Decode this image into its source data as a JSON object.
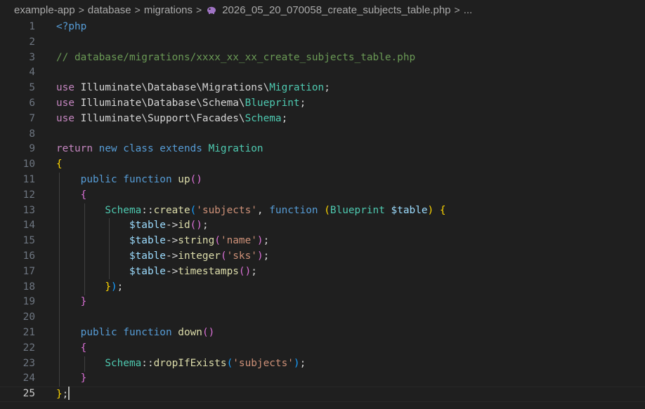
{
  "breadcrumb": {
    "items": [
      "example-app",
      "database",
      "migrations"
    ],
    "file": "2026_05_20_070058_create_subjects_table.php",
    "more": "...",
    "file_icon": "php-elephant-icon",
    "separator": ">"
  },
  "editor": {
    "active_line": 25,
    "lines": [
      {
        "n": "1",
        "tokens": [
          {
            "c": "t-tag",
            "t": "<?php"
          }
        ]
      },
      {
        "n": "2",
        "tokens": []
      },
      {
        "n": "3",
        "tokens": [
          {
            "c": "t-cmt",
            "t": "// database/migrations/xxxx_xx_xx_create_subjects_table.php"
          }
        ]
      },
      {
        "n": "4",
        "tokens": []
      },
      {
        "n": "5",
        "tokens": [
          {
            "c": "t-ctrl",
            "t": "use "
          },
          {
            "c": "t-txt",
            "t": "Illuminate\\Database\\Migrations\\"
          },
          {
            "c": "t-cls",
            "t": "Migration"
          },
          {
            "c": "t-txt",
            "t": ";"
          }
        ]
      },
      {
        "n": "6",
        "tokens": [
          {
            "c": "t-ctrl",
            "t": "use "
          },
          {
            "c": "t-txt",
            "t": "Illuminate\\Database\\Schema\\"
          },
          {
            "c": "t-cls",
            "t": "Blueprint"
          },
          {
            "c": "t-txt",
            "t": ";"
          }
        ]
      },
      {
        "n": "7",
        "tokens": [
          {
            "c": "t-ctrl",
            "t": "use "
          },
          {
            "c": "t-txt",
            "t": "Illuminate\\Support\\Facades\\"
          },
          {
            "c": "t-cls",
            "t": "Schema"
          },
          {
            "c": "t-txt",
            "t": ";"
          }
        ]
      },
      {
        "n": "8",
        "tokens": []
      },
      {
        "n": "9",
        "tokens": [
          {
            "c": "t-ctrl",
            "t": "return "
          },
          {
            "c": "t-kw",
            "t": "new class extends "
          },
          {
            "c": "t-cls",
            "t": "Migration"
          }
        ]
      },
      {
        "n": "10",
        "tokens": [
          {
            "c": "t-b1",
            "t": "{"
          }
        ]
      },
      {
        "n": "11",
        "tokens": [
          {
            "c": "t-txt",
            "t": "    "
          },
          {
            "c": "t-kw",
            "t": "public function "
          },
          {
            "c": "t-fn",
            "t": "up"
          },
          {
            "c": "t-b2",
            "t": "()"
          }
        ]
      },
      {
        "n": "12",
        "tokens": [
          {
            "c": "t-txt",
            "t": "    "
          },
          {
            "c": "t-b2",
            "t": "{"
          }
        ]
      },
      {
        "n": "13",
        "tokens": [
          {
            "c": "t-txt",
            "t": "        "
          },
          {
            "c": "t-cls",
            "t": "Schema"
          },
          {
            "c": "t-op",
            "t": "::"
          },
          {
            "c": "t-fn",
            "t": "create"
          },
          {
            "c": "t-b3",
            "t": "("
          },
          {
            "c": "t-str",
            "t": "'subjects'"
          },
          {
            "c": "t-txt",
            "t": ", "
          },
          {
            "c": "t-kw",
            "t": "function "
          },
          {
            "c": "t-b1",
            "t": "("
          },
          {
            "c": "t-cls",
            "t": "Blueprint "
          },
          {
            "c": "t-var",
            "t": "$table"
          },
          {
            "c": "t-b1",
            "t": ")"
          },
          {
            "c": "t-txt",
            "t": " "
          },
          {
            "c": "t-b1",
            "t": "{"
          }
        ]
      },
      {
        "n": "14",
        "tokens": [
          {
            "c": "t-txt",
            "t": "            "
          },
          {
            "c": "t-var",
            "t": "$table"
          },
          {
            "c": "t-op",
            "t": "->"
          },
          {
            "c": "t-fn",
            "t": "id"
          },
          {
            "c": "t-b2",
            "t": "()"
          },
          {
            "c": "t-txt",
            "t": ";"
          }
        ]
      },
      {
        "n": "15",
        "tokens": [
          {
            "c": "t-txt",
            "t": "            "
          },
          {
            "c": "t-var",
            "t": "$table"
          },
          {
            "c": "t-op",
            "t": "->"
          },
          {
            "c": "t-fn",
            "t": "string"
          },
          {
            "c": "t-b2",
            "t": "("
          },
          {
            "c": "t-str",
            "t": "'name'"
          },
          {
            "c": "t-b2",
            "t": ")"
          },
          {
            "c": "t-txt",
            "t": ";"
          }
        ]
      },
      {
        "n": "16",
        "tokens": [
          {
            "c": "t-txt",
            "t": "            "
          },
          {
            "c": "t-var",
            "t": "$table"
          },
          {
            "c": "t-op",
            "t": "->"
          },
          {
            "c": "t-fn",
            "t": "integer"
          },
          {
            "c": "t-b2",
            "t": "("
          },
          {
            "c": "t-str",
            "t": "'sks'"
          },
          {
            "c": "t-b2",
            "t": ")"
          },
          {
            "c": "t-txt",
            "t": ";"
          }
        ]
      },
      {
        "n": "17",
        "tokens": [
          {
            "c": "t-txt",
            "t": "            "
          },
          {
            "c": "t-var",
            "t": "$table"
          },
          {
            "c": "t-op",
            "t": "->"
          },
          {
            "c": "t-fn",
            "t": "timestamps"
          },
          {
            "c": "t-b2",
            "t": "()"
          },
          {
            "c": "t-txt",
            "t": ";"
          }
        ]
      },
      {
        "n": "18",
        "tokens": [
          {
            "c": "t-txt",
            "t": "        "
          },
          {
            "c": "t-b1",
            "t": "}"
          },
          {
            "c": "t-b3",
            "t": ")"
          },
          {
            "c": "t-txt",
            "t": ";"
          }
        ]
      },
      {
        "n": "19",
        "tokens": [
          {
            "c": "t-txt",
            "t": "    "
          },
          {
            "c": "t-b2",
            "t": "}"
          }
        ]
      },
      {
        "n": "20",
        "tokens": []
      },
      {
        "n": "21",
        "tokens": [
          {
            "c": "t-txt",
            "t": "    "
          },
          {
            "c": "t-kw",
            "t": "public function "
          },
          {
            "c": "t-fn",
            "t": "down"
          },
          {
            "c": "t-b2",
            "t": "()"
          }
        ]
      },
      {
        "n": "22",
        "tokens": [
          {
            "c": "t-txt",
            "t": "    "
          },
          {
            "c": "t-b2",
            "t": "{"
          }
        ]
      },
      {
        "n": "23",
        "tokens": [
          {
            "c": "t-txt",
            "t": "        "
          },
          {
            "c": "t-cls",
            "t": "Schema"
          },
          {
            "c": "t-op",
            "t": "::"
          },
          {
            "c": "t-fn",
            "t": "dropIfExists"
          },
          {
            "c": "t-b3",
            "t": "("
          },
          {
            "c": "t-str",
            "t": "'subjects'"
          },
          {
            "c": "t-b3",
            "t": ")"
          },
          {
            "c": "t-txt",
            "t": ";"
          }
        ]
      },
      {
        "n": "24",
        "tokens": [
          {
            "c": "t-txt",
            "t": "    "
          },
          {
            "c": "t-b2",
            "t": "}"
          }
        ]
      },
      {
        "n": "25",
        "tokens": [
          {
            "c": "t-b1",
            "t": "}"
          },
          {
            "c": "t-txt",
            "t": ";"
          }
        ]
      }
    ]
  }
}
